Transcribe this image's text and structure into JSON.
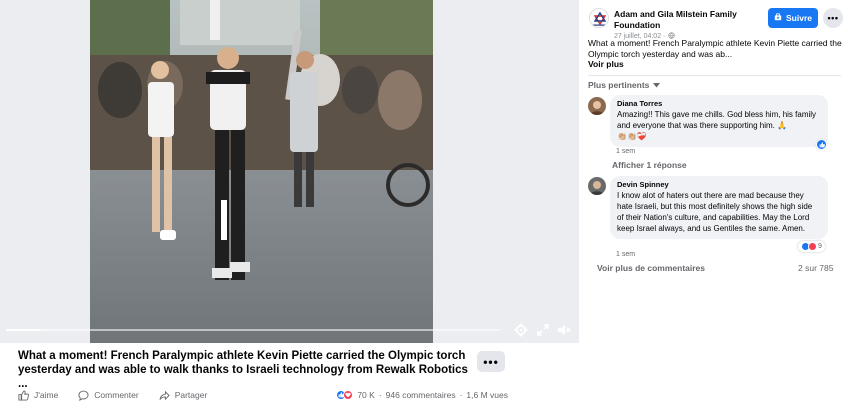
{
  "post": {
    "caption": "What a moment! French Paralympic athlete Kevin Piette carried the Olympic torch yesterday and was able to walk thanks to Israeli technology from Rewalk Robotics ...",
    "more_label": "•••",
    "actions": {
      "like": "J'aime",
      "comment": "Commenter",
      "share": "Partager"
    },
    "stats": {
      "reactions": "70 K",
      "separator": "·",
      "comments": "946 commentaires",
      "views": "1,6 M vues"
    }
  },
  "video": {
    "progress_fraction": 0.07,
    "icons": [
      "settings-icon",
      "fullscreen-icon",
      "volume-muted-icon"
    ]
  },
  "panel": {
    "page_name": "Adam and Gila Milstein Family Foundation",
    "date": "27 juillet, 04:02 ·",
    "follow_label": "Suivre",
    "more_label": "•••",
    "post_text": "What a moment! French Paralympic athlete Kevin Piette carried the Olympic torch yesterday and was ab...",
    "see_more": "Voir plus",
    "sort_label": "Plus pertinents",
    "comments": [
      {
        "author": "Diana Torres",
        "text": "Amazing!! This gave me chills. God bless him, his family and everyone that was there supporting him. 🙏",
        "emojis": "👏🏼👏🏼❤️‍🩹",
        "time": "1 sem",
        "replies_label": "Afficher 1 réponse"
      },
      {
        "author": "Devin Spinney",
        "text": "I know alot of haters out there are mad because they hate Israeli, but this most definitely shows the high side of their Nation's culture, and capabilities. May the Lord keep Israel always, and us Gentiles the same. Amen.",
        "reaction_count": "9",
        "time": "1 sem"
      }
    ],
    "more_comments": "Voir plus de commentaires",
    "count": "2 sur 785"
  },
  "colors": {
    "accent": "#1877f2",
    "secondary_text": "#65676b",
    "bubble": "#f0f2f5"
  }
}
